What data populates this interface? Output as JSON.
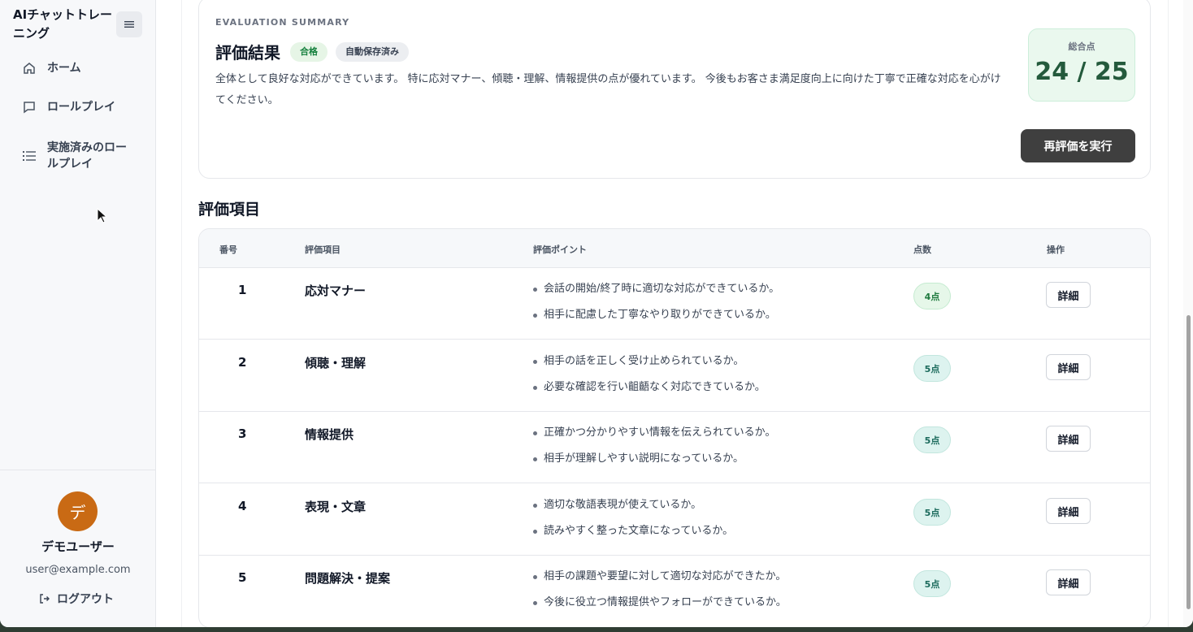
{
  "app": {
    "title": "AIチャットトレーニング",
    "menu_toggle_icon": "menu-icon"
  },
  "sidebar": {
    "items": [
      {
        "label": "ホーム",
        "icon": "home-icon"
      },
      {
        "label": "ロールプレイ",
        "icon": "chat-icon"
      },
      {
        "label": "実施済みのロールプレイ",
        "icon": "list-icon"
      }
    ],
    "user": {
      "avatar_initial": "デ",
      "avatar_color": "#c96a14",
      "name": "デモユーザー",
      "email": "user@example.com"
    },
    "logout_label": "ログアウト"
  },
  "summary": {
    "eyebrow": "EVALUATION SUMMARY",
    "title": "評価結果",
    "badge_pass": "合格",
    "badge_saved": "自動保存済み",
    "text": "全体として良好な対応ができています。 特に応対マナー、傾聴・理解、情報提供の点が優れています。 今後もお客さま満足度向上に向けた丁寧で正確な対応を心がけてください。",
    "score_label": "総合点",
    "score_value": "24 / 25",
    "rerun_label": "再評価を実行"
  },
  "evaluation": {
    "section_title": "評価項目",
    "headers": {
      "num": "番号",
      "item": "評価項目",
      "point": "評価ポイント",
      "score": "点数",
      "op": "操作"
    },
    "rows": [
      {
        "num": "1",
        "item": "応対マナー",
        "points": [
          "会話の開始/終了時に適切な対応ができているか。",
          "相手に配慮した丁寧なやり取りができているか。"
        ],
        "score": "4点",
        "detail": "詳細"
      },
      {
        "num": "2",
        "item": "傾聴・理解",
        "points": [
          "相手の話を正しく受け止められているか。",
          "必要な確認を行い齟齬なく対応できているか。"
        ],
        "score": "5点",
        "detail": "詳細"
      },
      {
        "num": "3",
        "item": "情報提供",
        "points": [
          "正確かつ分かりやすい情報を伝えられているか。",
          "相手が理解しやすい説明になっているか。"
        ],
        "score": "5点",
        "detail": "詳細"
      },
      {
        "num": "4",
        "item": "表現・文章",
        "points": [
          "適切な敬語表現が使えているか。",
          "読みやすく整った文章になっているか。"
        ],
        "score": "5点",
        "detail": "詳細"
      },
      {
        "num": "5",
        "item": "問題解決・提案",
        "points": [
          "相手の課題や要望に対して適切な対応ができたか。",
          "今後に役立つ情報提供やフォローができているか。"
        ],
        "score": "5点",
        "detail": "詳細"
      }
    ]
  }
}
